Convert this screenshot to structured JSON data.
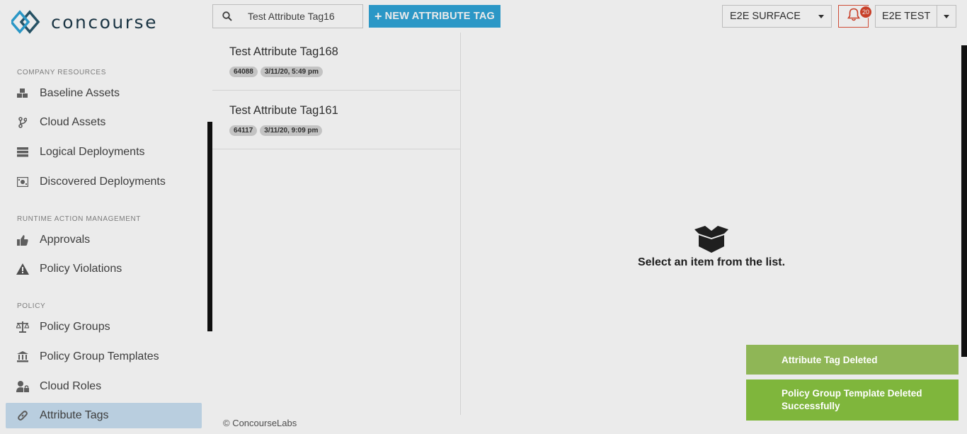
{
  "app": {
    "brand": "concourse"
  },
  "sidebar": {
    "sections": [
      {
        "label": "COMPANY RESOURCES"
      },
      {
        "label": "RUNTIME ACTION MANAGEMENT"
      },
      {
        "label": "POLICY"
      }
    ],
    "items": [
      {
        "label": "Baseline Assets",
        "icon": "cubes-icon"
      },
      {
        "label": "Cloud Assets",
        "icon": "branch-icon"
      },
      {
        "label": "Logical Deployments",
        "icon": "server-icon"
      },
      {
        "label": "Discovered Deployments",
        "icon": "scan-icon"
      },
      {
        "label": "Approvals",
        "icon": "thumbs-up-icon"
      },
      {
        "label": "Policy Violations",
        "icon": "warning-icon"
      },
      {
        "label": "Policy Groups",
        "icon": "scale-icon"
      },
      {
        "label": "Policy Group Templates",
        "icon": "bank-icon"
      },
      {
        "label": "Cloud Roles",
        "icon": "user-lock-icon"
      },
      {
        "label": "Attribute Tags",
        "icon": "link-icon",
        "active": true
      }
    ]
  },
  "topbar": {
    "search_value": "Test Attribute Tag16",
    "new_button_label": "NEW ATTRIBUTE TAG",
    "surface_select": "E2E SURFACE",
    "notification_count": "20",
    "user_label": "E2E TEST"
  },
  "list": {
    "items": [
      {
        "title": "Test Attribute Tag168",
        "id": "64088",
        "date": "3/11/20, 5:49 pm"
      },
      {
        "title": "Test Attribute Tag161",
        "id": "64117",
        "date": "3/11/20, 9:09 pm"
      }
    ]
  },
  "detail": {
    "empty_text": "Select an item from the list."
  },
  "footer": {
    "text": "© ConcourseLabs"
  },
  "toasts": [
    {
      "text": "Attribute Tag Deleted"
    },
    {
      "text": "Policy Group Template Deleted Successfully"
    }
  ],
  "colors": {
    "accent": "#2fa4d7",
    "active_nav": "#c9e0f2",
    "toast_green": "#7fb63c",
    "alert_red": "#d9452c"
  }
}
